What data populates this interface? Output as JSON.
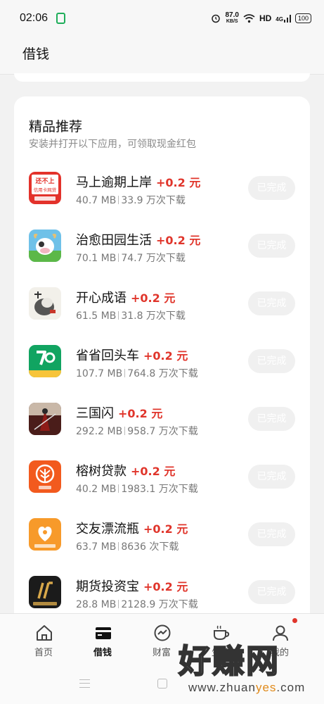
{
  "status_bar": {
    "time": "02:06",
    "net_speed": "87.0",
    "net_unit": "KB/S",
    "hd": "HD",
    "signal": "4G",
    "battery": "100"
  },
  "header": {
    "title": "借钱"
  },
  "section": {
    "title": "精品推荐",
    "subtitle": "安装并打开以下应用，可领取现金红包"
  },
  "apps": [
    {
      "name": "马上逾期上岸",
      "reward": "+0.2 元",
      "size": "40.7 MB",
      "downloads": "33.9 万次下载",
      "button": "已完成",
      "icon": "red-credit-card-icon",
      "icon_text": "还不上\n信用卡网贷"
    },
    {
      "name": "治愈田园生活",
      "reward": "+0.2 元",
      "size": "70.1 MB",
      "downloads": "74.7 万次下载",
      "button": "已完成",
      "icon": "cow-farm-icon"
    },
    {
      "name": "开心成语",
      "reward": "+0.2 元",
      "size": "61.5 MB",
      "downloads": "31.8 万次下载",
      "button": "已完成",
      "icon": "ink-idiom-icon"
    },
    {
      "name": "省省回头车",
      "reward": "+0.2 元",
      "size": "107.7 MB",
      "downloads": "764.8 万次下载",
      "button": "已完成",
      "icon": "green-truck-icon"
    },
    {
      "name": "三国闪",
      "reward": "+0.2 元",
      "size": "292.2 MB",
      "downloads": "958.7 万次下载",
      "button": "已完成",
      "icon": "warrior-icon"
    },
    {
      "name": "榕树贷款",
      "reward": "+0.2 元",
      "size": "40.2 MB",
      "downloads": "1983.1 万次下载",
      "button": "已完成",
      "icon": "orange-tree-icon"
    },
    {
      "name": "交友漂流瓶",
      "reward": "+0.2 元",
      "size": "63.7 MB",
      "downloads": "8636 次下载",
      "button": "已完成",
      "icon": "heart-bottle-icon"
    },
    {
      "name": "期货投资宝",
      "reward": "+0.2 元",
      "size": "28.8 MB",
      "downloads": "2128.9 万次下载",
      "button": "已完成",
      "icon": "black-gold-chart-icon"
    }
  ],
  "nav": [
    {
      "label": "首页",
      "icon": "home-icon"
    },
    {
      "label": "借钱",
      "icon": "card-icon",
      "active": true
    },
    {
      "label": "财富",
      "icon": "chart-circle-icon"
    },
    {
      "label": "生活",
      "icon": "coffee-cup-icon"
    },
    {
      "label": "我的",
      "icon": "person-icon",
      "badge": true
    }
  ],
  "watermark": {
    "big": "好赚网",
    "small_1": "www.zhuan",
    "small_2": "yes",
    "small_3": ".com"
  },
  "colors": {
    "reward": "#e0352b",
    "accent_green": "#1fae5a",
    "done_button_bg": "#f0f0f0"
  }
}
